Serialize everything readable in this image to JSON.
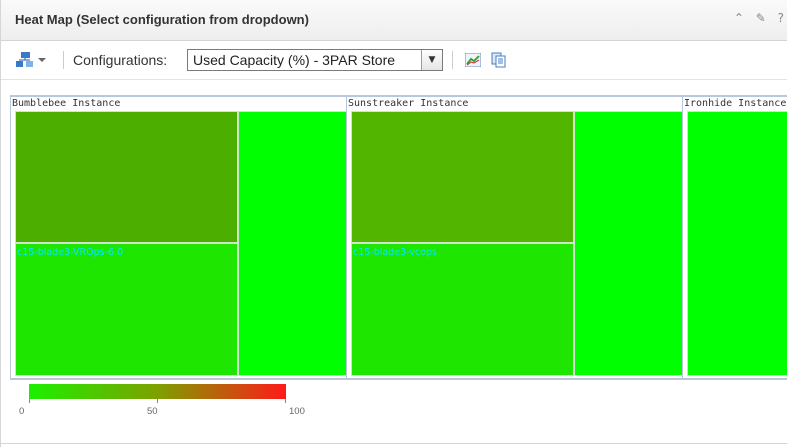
{
  "panel": {
    "title": "Heat Map (Select configuration from dropdown)",
    "header_icons": [
      "collapse-icon",
      "edit-pencil-icon",
      "help-icon"
    ],
    "header_icon_glyphs": {
      "collapse": "⌃",
      "edit": "✎",
      "help": "?"
    }
  },
  "toolbar": {
    "configurations_label": "Configurations:",
    "selected_configuration": "Used Capacity (%) - 3PAR Store",
    "icons": [
      "hierarchy-icon",
      "chevron-down-icon",
      "chart-icon",
      "copy-icon"
    ]
  },
  "heatmap": {
    "metric": "Used Capacity (%)",
    "groups": [
      {
        "name": "Bumblebee Instance",
        "cells": [
          {
            "label": "",
            "value": 30,
            "color": "#4caf00"
          },
          {
            "label": "c15-blade3-VROps-6.0",
            "value": 5,
            "color": "#1ee600"
          },
          {
            "label": "",
            "value": 0,
            "color": "#00ff00"
          }
        ]
      },
      {
        "name": "Sunstreaker Instance",
        "cells": [
          {
            "label": "",
            "value": 25,
            "color": "#52b600"
          },
          {
            "label": "c15-blade3-vcops",
            "value": 5,
            "color": "#1ee600"
          },
          {
            "label": "",
            "value": 0,
            "color": "#00ff00"
          }
        ]
      },
      {
        "name": "Ironhide Instance",
        "cells": [
          {
            "label": "",
            "value": 0,
            "color": "#00ff00"
          }
        ]
      }
    ]
  },
  "legend": {
    "min_label": "0",
    "mid_label": "50",
    "max_label": "100",
    "colors": {
      "low": "#1cf000",
      "mid": "#7ea000",
      "high": "#ff1a1a"
    }
  }
}
